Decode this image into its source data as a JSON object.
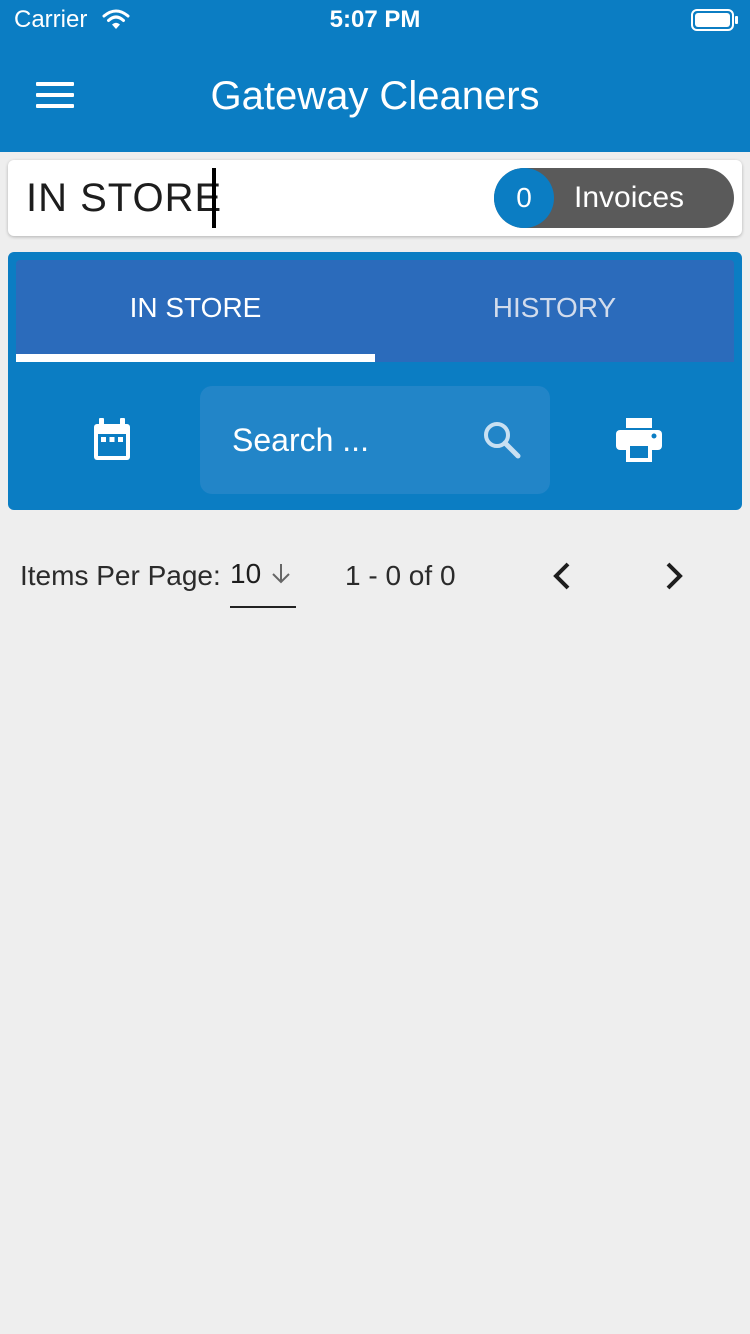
{
  "status_bar": {
    "carrier": "Carrier",
    "time": "5:07 PM"
  },
  "header": {
    "title": "Gateway Cleaners",
    "menu_icon": "hamburger-menu-icon"
  },
  "store_bar": {
    "label": "IN STORE",
    "invoice_count": "0",
    "invoices_label": "Invoices"
  },
  "tabs": [
    {
      "label": "IN STORE",
      "active": true
    },
    {
      "label": "HISTORY",
      "active": false
    }
  ],
  "toolbar": {
    "calendar_icon": "calendar-icon",
    "search_placeholder": "Search ...",
    "search_icon": "magnifier-icon",
    "print_icon": "printer-icon"
  },
  "pagination": {
    "items_per_page_label": "Items Per Page:",
    "items_per_page_value": "10",
    "range_text": "1 - 0 of 0",
    "prev_icon": "chevron-left-icon",
    "next_icon": "chevron-right-icon"
  },
  "colors": {
    "primary": "#0b7dc3",
    "tab_bar": "#2b6bbb",
    "pill": "#5a5a5a",
    "background": "#eeeeee"
  }
}
